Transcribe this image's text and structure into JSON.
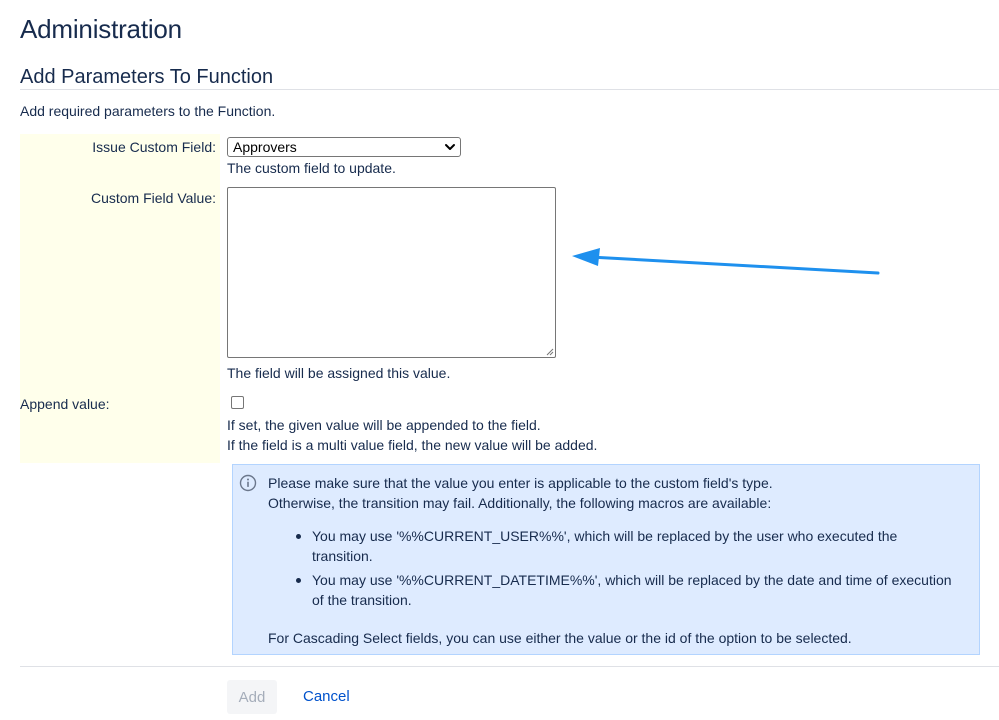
{
  "page": {
    "title": "Administration"
  },
  "section": {
    "title": "Add Parameters To Function",
    "description": "Add required parameters to the Function."
  },
  "form": {
    "issue_custom_field": {
      "label": "Issue Custom Field:",
      "selected_value": "Approvers",
      "help": "The custom field to update."
    },
    "custom_field_value": {
      "label": "Custom Field Value:",
      "value": "",
      "help": "The field will be assigned this value."
    },
    "append_value": {
      "label": "Append value:",
      "checked": false,
      "help_line_1": "If set, the given value will be appended to the field.",
      "help_line_2": "If the field is a multi value field, the new value will be added."
    }
  },
  "info_box": {
    "line_1": "Please make sure that the value you enter is applicable to the custom field's type.",
    "line_2": "Otherwise, the transition may fail. Additionally, the following macros are available:",
    "bullets": [
      {
        "line_1": "You may use '%%CURRENT_USER%%', which will be replaced by the user who executed the",
        "line_2": "transition."
      },
      {
        "line_1": "You may use '%%CURRENT_DATETIME%%', which will be replaced by the date and time of execution",
        "line_2": "of the transition."
      }
    ],
    "footer": "For Cascading Select fields, you can use either the value or the id of the option to be selected.",
    "icon": "info-icon"
  },
  "actions": {
    "add_label": "Add",
    "cancel_label": "Cancel"
  },
  "annotation": {
    "arrow_color": "#1e90ee"
  }
}
